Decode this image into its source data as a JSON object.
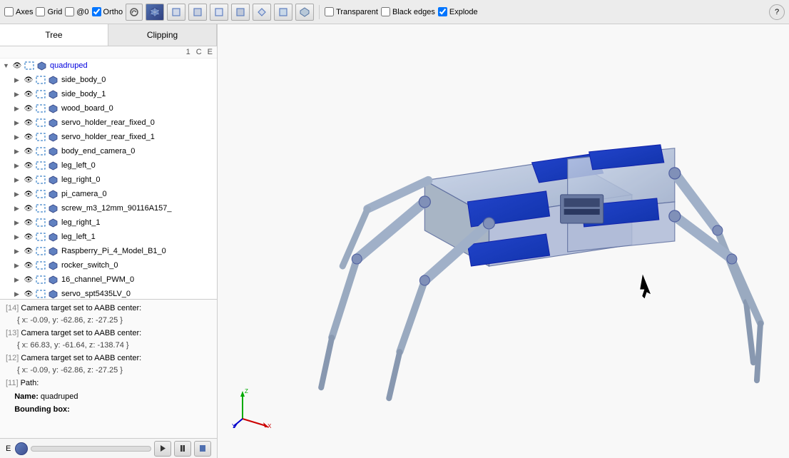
{
  "toolbar": {
    "axes_label": "Axes",
    "grid_label": "Grid",
    "at0_label": "@0",
    "ortho_label": "Ortho",
    "transparent_label": "Transparent",
    "black_edges_label": "Black edges",
    "explode_label": "Explode",
    "help_label": "?",
    "ortho_checked": true,
    "explode_checked": true,
    "view_cubes": [
      "top",
      "front",
      "right",
      "left",
      "back",
      "bottom",
      "iso1",
      "iso2"
    ]
  },
  "tabs": {
    "tree_label": "Tree",
    "clipping_label": "Clipping"
  },
  "tree_header": {
    "col1": "1",
    "col2": "C",
    "col3": "E"
  },
  "tree_items": [
    {
      "id": "root",
      "label": "quadruped",
      "indent": 0,
      "is_root": true
    },
    {
      "id": "1",
      "label": "side_body_0",
      "indent": 1
    },
    {
      "id": "2",
      "label": "side_body_1",
      "indent": 1
    },
    {
      "id": "3",
      "label": "wood_board_0",
      "indent": 1
    },
    {
      "id": "4",
      "label": "servo_holder_rear_fixed_0",
      "indent": 1
    },
    {
      "id": "5",
      "label": "servo_holder_rear_fixed_1",
      "indent": 1
    },
    {
      "id": "6",
      "label": "body_end_camera_0",
      "indent": 1
    },
    {
      "id": "7",
      "label": "leg_left_0",
      "indent": 1
    },
    {
      "id": "8",
      "label": "leg_right_0",
      "indent": 1
    },
    {
      "id": "9",
      "label": "pi_camera_0",
      "indent": 1
    },
    {
      "id": "10",
      "label": "screw_m3_12mm_90116A157_",
      "indent": 1
    },
    {
      "id": "11",
      "label": "leg_right_1",
      "indent": 1
    },
    {
      "id": "12",
      "label": "leg_left_1",
      "indent": 1
    },
    {
      "id": "13",
      "label": "Raspberry_Pi_4_Model_B1_0",
      "indent": 1
    },
    {
      "id": "14",
      "label": "rocker_switch_0",
      "indent": 1
    },
    {
      "id": "15",
      "label": "16_channel_PWM_0",
      "indent": 1
    },
    {
      "id": "16",
      "label": "servo_spt5435LV_0",
      "indent": 1
    }
  ],
  "console": {
    "entries": [
      {
        "num": "[14]",
        "text": "Camera target set to AABB center:",
        "detail": "{ x: -0.09, y: -62.86, z: -27.25 }"
      },
      {
        "num": "[13]",
        "text": "Camera target set to AABB center:",
        "detail": "{ x: 66.83, y: -61.64, z: -138.74 }"
      },
      {
        "num": "[12]",
        "text": "Camera target set to AABB center:",
        "detail": "{ x: -0.09, y: -62.86, z: -27.25 }"
      },
      {
        "num": "[11]",
        "text": "Path:",
        "detail": null
      },
      {
        "name_label": "Name:",
        "name_val": "quadruped"
      },
      {
        "bb_label": "Bounding box:"
      }
    ]
  },
  "bottom": {
    "e_label": "E"
  }
}
